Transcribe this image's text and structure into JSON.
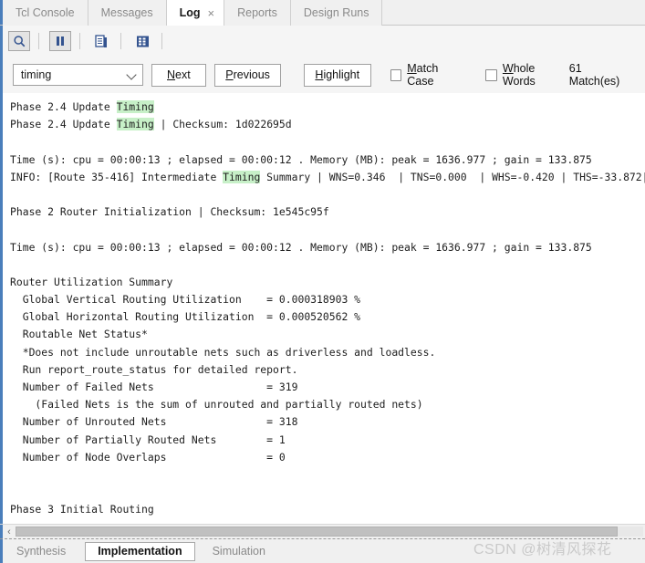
{
  "top_tabs": [
    {
      "label": "Tcl Console",
      "active": false
    },
    {
      "label": "Messages",
      "active": false
    },
    {
      "label": "Log",
      "active": true,
      "close": "×"
    },
    {
      "label": "Reports",
      "active": false
    },
    {
      "label": "Design Runs",
      "active": false
    }
  ],
  "toolbar": {
    "icons": [
      {
        "name": "search-icon",
        "glyph": "search",
        "framed": true
      },
      {
        "name": "pause-icon",
        "glyph": "pause",
        "framed": true
      },
      {
        "name": "report-document-icon",
        "glyph": "document",
        "framed": false
      },
      {
        "name": "table-grid-icon",
        "glyph": "table",
        "framed": false
      }
    ]
  },
  "findbar": {
    "search_value": "timing",
    "search_placeholder": "",
    "next_label": "Next",
    "previous_label": "Previous",
    "highlight_label": "Highlight",
    "match_case_label": "Match Case",
    "match_case_checked": false,
    "whole_words_label": "Whole Words",
    "whole_words_checked": false,
    "match_count_label": "61 Match(es)"
  },
  "log": {
    "highlight_term": "Timing",
    "highlight_color": "#c7f0c8",
    "lines": [
      "Phase 2.4 Update Timing",
      "Phase 2.4 Update Timing | Checksum: 1d022695d",
      "",
      "Time (s): cpu = 00:00:13 ; elapsed = 00:00:12 . Memory (MB): peak = 1636.977 ; gain = 133.875",
      "INFO: [Route 35-416] Intermediate Timing Summary | WNS=0.346  | TNS=0.000  | WHS=-0.420 | THS=-33.872|",
      "",
      "Phase 2 Router Initialization | Checksum: 1e545c95f",
      "",
      "Time (s): cpu = 00:00:13 ; elapsed = 00:00:12 . Memory (MB): peak = 1636.977 ; gain = 133.875",
      "",
      "Router Utilization Summary",
      "  Global Vertical Routing Utilization    = 0.000318903 %",
      "  Global Horizontal Routing Utilization  = 0.000520562 %",
      "  Routable Net Status*",
      "  *Does not include unroutable nets such as driverless and loadless.",
      "  Run report_route_status for detailed report.",
      "  Number of Failed Nets                  = 319",
      "    (Failed Nets is the sum of unrouted and partially routed nets)",
      "  Number of Unrouted Nets                = 318",
      "  Number of Partially Routed Nets        = 1",
      "  Number of Node Overlaps                = 0",
      "",
      "",
      "Phase 3 Initial Routing"
    ]
  },
  "scrollbar": {
    "left_arrow": "‹"
  },
  "bottom_tabs": [
    {
      "label": "Synthesis",
      "active": false
    },
    {
      "label": "Implementation",
      "active": true
    },
    {
      "label": "Simulation",
      "active": false
    }
  ],
  "watermark": {
    "text": "CSDN @树清风探花"
  }
}
